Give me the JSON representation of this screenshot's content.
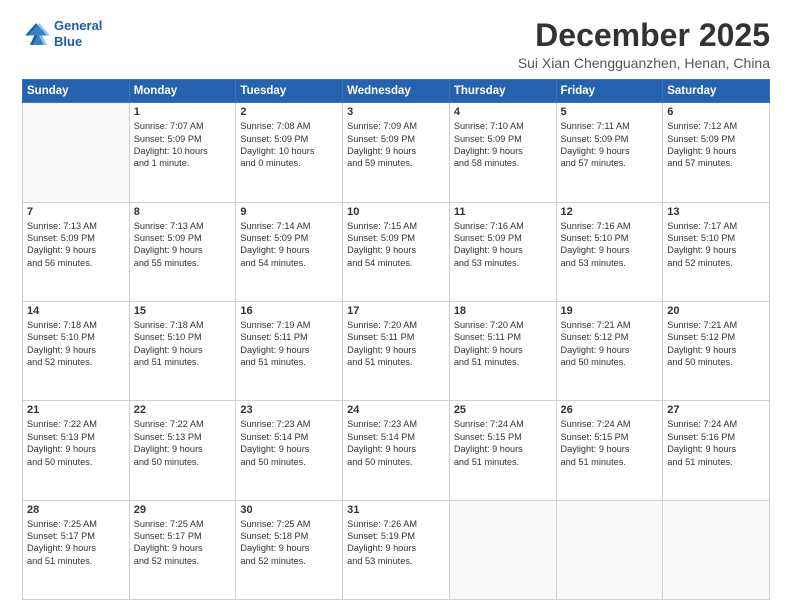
{
  "header": {
    "logo_line1": "General",
    "logo_line2": "Blue",
    "month": "December 2025",
    "location": "Sui Xian Chengguanzhen, Henan, China"
  },
  "weekdays": [
    "Sunday",
    "Monday",
    "Tuesday",
    "Wednesday",
    "Thursday",
    "Friday",
    "Saturday"
  ],
  "weeks": [
    [
      {
        "day": "",
        "text": ""
      },
      {
        "day": "1",
        "text": "Sunrise: 7:07 AM\nSunset: 5:09 PM\nDaylight: 10 hours\nand 1 minute."
      },
      {
        "day": "2",
        "text": "Sunrise: 7:08 AM\nSunset: 5:09 PM\nDaylight: 10 hours\nand 0 minutes."
      },
      {
        "day": "3",
        "text": "Sunrise: 7:09 AM\nSunset: 5:09 PM\nDaylight: 9 hours\nand 59 minutes."
      },
      {
        "day": "4",
        "text": "Sunrise: 7:10 AM\nSunset: 5:09 PM\nDaylight: 9 hours\nand 58 minutes."
      },
      {
        "day": "5",
        "text": "Sunrise: 7:11 AM\nSunset: 5:09 PM\nDaylight: 9 hours\nand 57 minutes."
      },
      {
        "day": "6",
        "text": "Sunrise: 7:12 AM\nSunset: 5:09 PM\nDaylight: 9 hours\nand 57 minutes."
      }
    ],
    [
      {
        "day": "7",
        "text": "Sunrise: 7:13 AM\nSunset: 5:09 PM\nDaylight: 9 hours\nand 56 minutes."
      },
      {
        "day": "8",
        "text": "Sunrise: 7:13 AM\nSunset: 5:09 PM\nDaylight: 9 hours\nand 55 minutes."
      },
      {
        "day": "9",
        "text": "Sunrise: 7:14 AM\nSunset: 5:09 PM\nDaylight: 9 hours\nand 54 minutes."
      },
      {
        "day": "10",
        "text": "Sunrise: 7:15 AM\nSunset: 5:09 PM\nDaylight: 9 hours\nand 54 minutes."
      },
      {
        "day": "11",
        "text": "Sunrise: 7:16 AM\nSunset: 5:09 PM\nDaylight: 9 hours\nand 53 minutes."
      },
      {
        "day": "12",
        "text": "Sunrise: 7:16 AM\nSunset: 5:10 PM\nDaylight: 9 hours\nand 53 minutes."
      },
      {
        "day": "13",
        "text": "Sunrise: 7:17 AM\nSunset: 5:10 PM\nDaylight: 9 hours\nand 52 minutes."
      }
    ],
    [
      {
        "day": "14",
        "text": "Sunrise: 7:18 AM\nSunset: 5:10 PM\nDaylight: 9 hours\nand 52 minutes."
      },
      {
        "day": "15",
        "text": "Sunrise: 7:18 AM\nSunset: 5:10 PM\nDaylight: 9 hours\nand 51 minutes."
      },
      {
        "day": "16",
        "text": "Sunrise: 7:19 AM\nSunset: 5:11 PM\nDaylight: 9 hours\nand 51 minutes."
      },
      {
        "day": "17",
        "text": "Sunrise: 7:20 AM\nSunset: 5:11 PM\nDaylight: 9 hours\nand 51 minutes."
      },
      {
        "day": "18",
        "text": "Sunrise: 7:20 AM\nSunset: 5:11 PM\nDaylight: 9 hours\nand 51 minutes."
      },
      {
        "day": "19",
        "text": "Sunrise: 7:21 AM\nSunset: 5:12 PM\nDaylight: 9 hours\nand 50 minutes."
      },
      {
        "day": "20",
        "text": "Sunrise: 7:21 AM\nSunset: 5:12 PM\nDaylight: 9 hours\nand 50 minutes."
      }
    ],
    [
      {
        "day": "21",
        "text": "Sunrise: 7:22 AM\nSunset: 5:13 PM\nDaylight: 9 hours\nand 50 minutes."
      },
      {
        "day": "22",
        "text": "Sunrise: 7:22 AM\nSunset: 5:13 PM\nDaylight: 9 hours\nand 50 minutes."
      },
      {
        "day": "23",
        "text": "Sunrise: 7:23 AM\nSunset: 5:14 PM\nDaylight: 9 hours\nand 50 minutes."
      },
      {
        "day": "24",
        "text": "Sunrise: 7:23 AM\nSunset: 5:14 PM\nDaylight: 9 hours\nand 50 minutes."
      },
      {
        "day": "25",
        "text": "Sunrise: 7:24 AM\nSunset: 5:15 PM\nDaylight: 9 hours\nand 51 minutes."
      },
      {
        "day": "26",
        "text": "Sunrise: 7:24 AM\nSunset: 5:15 PM\nDaylight: 9 hours\nand 51 minutes."
      },
      {
        "day": "27",
        "text": "Sunrise: 7:24 AM\nSunset: 5:16 PM\nDaylight: 9 hours\nand 51 minutes."
      }
    ],
    [
      {
        "day": "28",
        "text": "Sunrise: 7:25 AM\nSunset: 5:17 PM\nDaylight: 9 hours\nand 51 minutes."
      },
      {
        "day": "29",
        "text": "Sunrise: 7:25 AM\nSunset: 5:17 PM\nDaylight: 9 hours\nand 52 minutes."
      },
      {
        "day": "30",
        "text": "Sunrise: 7:25 AM\nSunset: 5:18 PM\nDaylight: 9 hours\nand 52 minutes."
      },
      {
        "day": "31",
        "text": "Sunrise: 7:26 AM\nSunset: 5:19 PM\nDaylight: 9 hours\nand 53 minutes."
      },
      {
        "day": "",
        "text": ""
      },
      {
        "day": "",
        "text": ""
      },
      {
        "day": "",
        "text": ""
      }
    ]
  ]
}
